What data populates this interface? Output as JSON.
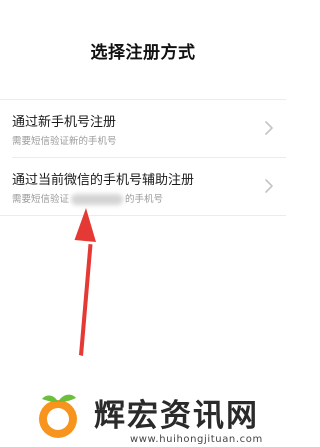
{
  "page": {
    "title": "选择注册方式"
  },
  "options": [
    {
      "main": "通过新手机号注册",
      "sub": "需要短信验证新的手机号",
      "chevron_icon": "chevron-right-icon"
    },
    {
      "main": "通过当前微信的手机号辅助注册",
      "sub_prefix": "需要短信验证",
      "sub_suffix": "的手机号",
      "chevron_icon": "chevron-right-icon"
    }
  ],
  "annotation": {
    "icon": "red-arrow-up-icon",
    "color": "#e53935"
  },
  "watermark": {
    "text": "辉宏资讯网",
    "url": "www.huihongjituan.com",
    "logo_icon": "orange-fruit-icon",
    "logo_color": "#f7941d",
    "leaf_color": "#6bbf3a"
  },
  "colors": {
    "background": "#ffffff",
    "primary_text": "#1a1a1a",
    "secondary_text": "#9a9a9a",
    "divider": "#ececec",
    "chevron": "#c4c4c4"
  }
}
